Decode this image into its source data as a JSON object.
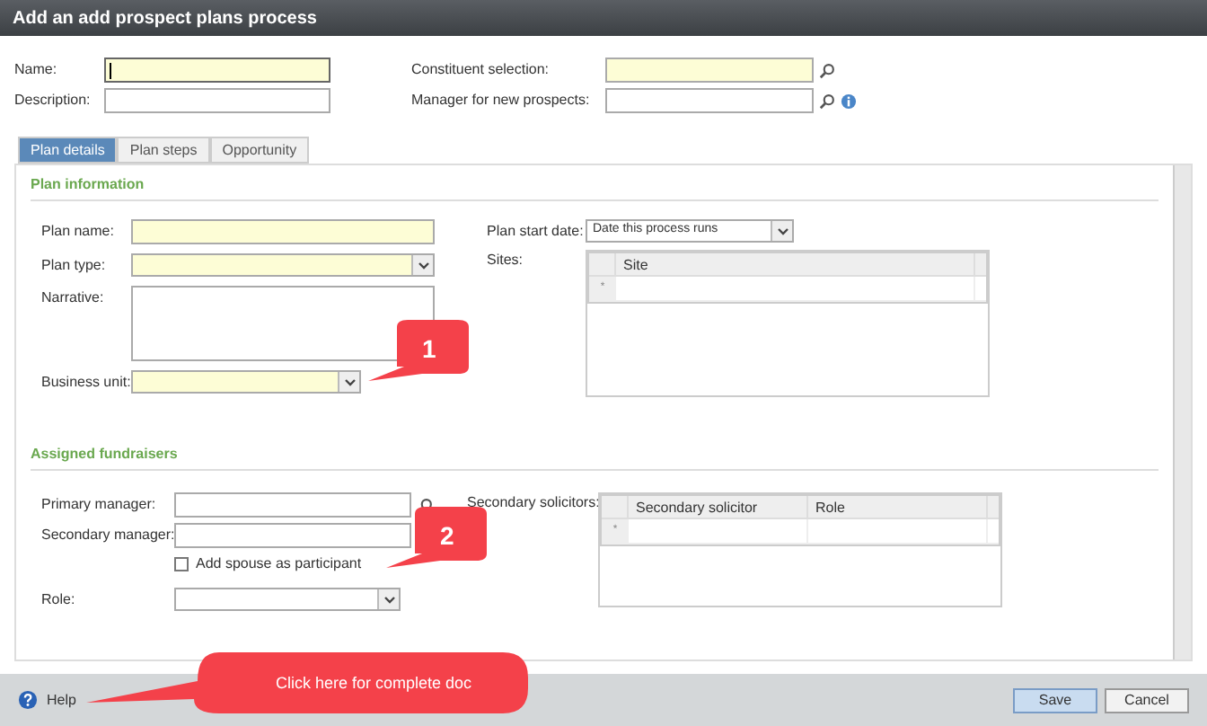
{
  "window": {
    "title": "Add an add prospect plans process"
  },
  "header_fields": [
    {
      "label": "Name:",
      "kind": "text",
      "required": true,
      "focused": true
    },
    {
      "label": "Constituent selection:",
      "kind": "search",
      "required": true,
      "focused": false
    },
    {
      "label": "Description:",
      "kind": "text",
      "required": false,
      "focused": false
    },
    {
      "label": "Manager for new prospects:",
      "kind": "search",
      "required": false,
      "focused": false,
      "info": true
    }
  ],
  "tabs": [
    {
      "label": "Plan details",
      "selected": true
    },
    {
      "label": "Plan steps",
      "selected": false
    },
    {
      "label": "Opportunity",
      "selected": false
    }
  ],
  "plan_information": {
    "title": "Plan information",
    "fields": [
      {
        "label": "Plan name:",
        "kind": "text",
        "required": true
      },
      {
        "label": "Plan type:",
        "kind": "select",
        "required": true
      },
      {
        "label": "Narrative:",
        "kind": "textarea",
        "required": false
      },
      {
        "label": "Business unit:",
        "kind": "select",
        "required": true
      }
    ],
    "plan_start_date": {
      "label": "Plan start date:",
      "value": "Date this process runs"
    },
    "sites": {
      "label": "Sites:",
      "columns": [
        "Site"
      ],
      "new_row_marker": "*"
    }
  },
  "assigned_fundraisers": {
    "title": "Assigned fundraisers",
    "fields": [
      {
        "label": "Primary manager:",
        "kind": "search",
        "required": false
      },
      {
        "label": "Secondary manager:",
        "kind": "text",
        "required": false
      },
      {
        "label": "Add spouse as participant",
        "kind": "checkbox",
        "checked": false
      },
      {
        "label": "Role:",
        "kind": "select",
        "required": false
      }
    ],
    "secondary_solicitors": {
      "label": "Secondary solicitors:",
      "columns": [
        "Secondary solicitor",
        "Role"
      ],
      "new_row_marker": "*"
    }
  },
  "footer": {
    "help": "Help",
    "buttons": [
      {
        "label": "Save",
        "primary": true
      },
      {
        "label": "Cancel",
        "primary": false
      }
    ]
  },
  "callouts": [
    {
      "kind": "number",
      "text": "1"
    },
    {
      "kind": "number",
      "text": "2"
    },
    {
      "kind": "banner",
      "text": "Click here for complete doc"
    }
  ]
}
